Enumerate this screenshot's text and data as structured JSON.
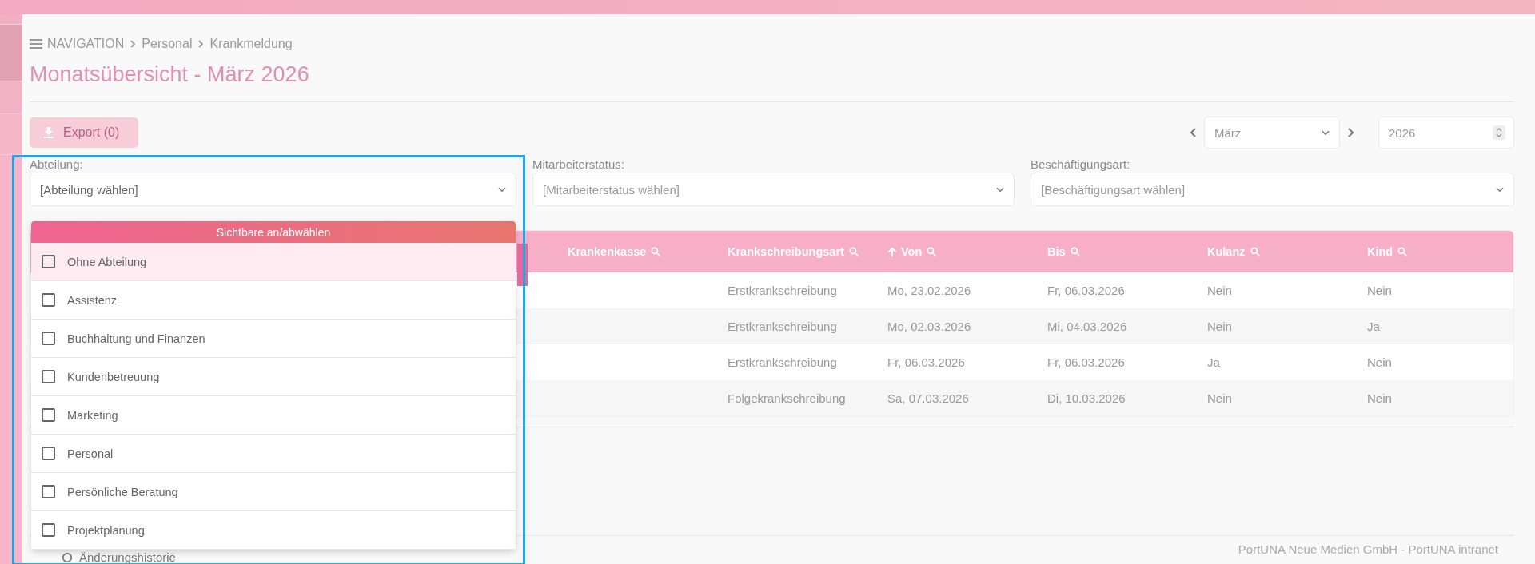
{
  "breadcrumb": {
    "menu_label": "NAVIGATION",
    "items": [
      "Personal",
      "Krankmeldung"
    ]
  },
  "title": "Monatsübersicht - März 2026",
  "export_button": {
    "label": "Export (0)",
    "disabled": true
  },
  "period": {
    "month": "März",
    "year": "2026"
  },
  "filters": [
    {
      "label": "Abteilung:",
      "placeholder": "[Abteilung wählen]",
      "expanded": true
    },
    {
      "label": "Mitarbeiterstatus:",
      "placeholder": "[Mitarbeiterstatus wählen]",
      "expanded": false
    },
    {
      "label": "Beschäftigungsart:",
      "placeholder": "[Beschäftigungsart wählen]",
      "expanded": false
    }
  ],
  "dropdown": {
    "toggle_label": "Sichtbare an/abwählen",
    "items": [
      {
        "label": "Ohne Abteilung",
        "checked": false,
        "highlighted": true
      },
      {
        "label": "Assistenz",
        "checked": false,
        "highlighted": false
      },
      {
        "label": "Buchhaltung und Finanzen",
        "checked": false,
        "highlighted": false
      },
      {
        "label": "Kundenbetreuung",
        "checked": false,
        "highlighted": false
      },
      {
        "label": "Marketing",
        "checked": false,
        "highlighted": false
      },
      {
        "label": "Personal",
        "checked": false,
        "highlighted": false
      },
      {
        "label": "Persönliche Beratung",
        "checked": false,
        "highlighted": false
      },
      {
        "label": "Projektplanung",
        "checked": false,
        "highlighted": false
      }
    ]
  },
  "table": {
    "columns": [
      {
        "label": "Krankenkasse",
        "sorted_ascending": false
      },
      {
        "label": "Krankschreibungsart",
        "sorted_ascending": false
      },
      {
        "label": "Von",
        "sorted_ascending": true
      },
      {
        "label": "Bis",
        "sorted_ascending": false
      },
      {
        "label": "Kulanz",
        "sorted_ascending": false
      },
      {
        "label": "Kind",
        "sorted_ascending": false
      }
    ],
    "rows": [
      [
        "",
        "Erstkrankschreibung",
        "Mo, 23.02.2026",
        "Fr, 06.03.2026",
        "Nein",
        "Nein"
      ],
      [
        "",
        "Erstkrankschreibung",
        "Mo, 02.03.2026",
        "Mi, 04.03.2026",
        "Nein",
        "Ja"
      ],
      [
        "",
        "Erstkrankschreibung",
        "Fr, 06.03.2026",
        "Fr, 06.03.2026",
        "Ja",
        "Nein"
      ],
      [
        "",
        "Folgekrankschreibung",
        "Sa, 07.03.2026",
        "Di, 10.03.2026",
        "Nein",
        "Nein"
      ]
    ]
  },
  "history_label": "Änderungshistorie",
  "footer": "PortUNA Neue Medien GmbH - PortUNA intranet"
}
